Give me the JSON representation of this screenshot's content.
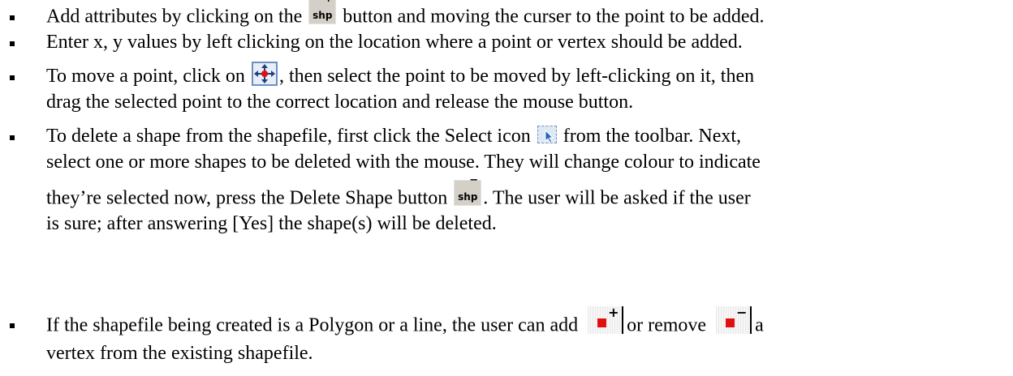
{
  "items": [
    {
      "lines": [
        [
          "Add attributes by clicking on the ",
          "button and moving the curser to the point to be added."
        ]
      ]
    },
    {
      "lines": [
        [
          "Enter x, y values by left clicking on the location where a point or vertex should be added."
        ]
      ]
    },
    {
      "lines": [
        [
          "To move a point, click on ",
          ", then select the point to be moved by left-clicking on it, then"
        ],
        [
          "drag the selected point to the correct location and release the mouse button."
        ]
      ]
    },
    {
      "lines": [
        [
          "To delete a shape from the shapefile, first click the Select icon ",
          " from the toolbar. Next,"
        ],
        [
          "select one or more shapes to be deleted with the mouse. They will change colour to indicate"
        ],
        [
          "they’re selected now, press the Delete Shape button ",
          ". The user will be asked if the user"
        ],
        [
          "is sure; after answering [Yes] the shape(s) will be deleted."
        ]
      ]
    },
    {
      "lines": [
        [
          "If the shapefile being created is a Polygon or a line, the user can add ",
          "or remove ",
          "a"
        ],
        [
          "vertex from the existing shapefile."
        ]
      ]
    }
  ],
  "icons": {
    "add_shape": {
      "label": "shp",
      "mark": "+"
    },
    "delete_shape": {
      "label": "shp",
      "mark": "−"
    },
    "add_vertex": {
      "mark": "+"
    },
    "remove_vertex": {
      "mark": "−"
    },
    "move_icon_color": "#e11010",
    "vertex_color": "#e11010"
  }
}
